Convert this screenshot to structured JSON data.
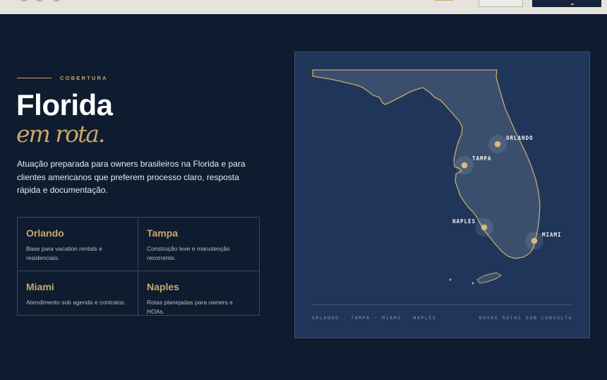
{
  "section": {
    "eyebrow": "COBERTURA",
    "title": "Florida",
    "subtitle": "em rota.",
    "lead": "Atuação preparada para owners brasileiros na Florida e para clientes americanos que preferem processo claro, resposta rápida e documentação."
  },
  "cities": [
    {
      "name": "Orlando",
      "description": "Base para vacation rentals e residenciais."
    },
    {
      "name": "Tampa",
      "description": "Construção leve e manutenção recorrente."
    },
    {
      "name": "Miami",
      "description": "Atendimento sob agenda e contratos."
    },
    {
      "name": "Naples",
      "description": "Rotas planejadas para owners e HOAs."
    }
  ],
  "map": {
    "pins": [
      {
        "label": "ORLANDO"
      },
      {
        "label": "TAMPA"
      },
      {
        "label": "NAPLES"
      },
      {
        "label": "MIAMI"
      }
    ],
    "footer_left": "ORLANDO · TAMPA · MIAMI · NAPLES",
    "footer_right": "NOVAS ROTAS SOB CONSULTA"
  },
  "colors": {
    "background": "#0f1b2e",
    "accent_gold": "#c9a86a",
    "map_panel": "#1f365a",
    "land": "#3a4f6e"
  }
}
